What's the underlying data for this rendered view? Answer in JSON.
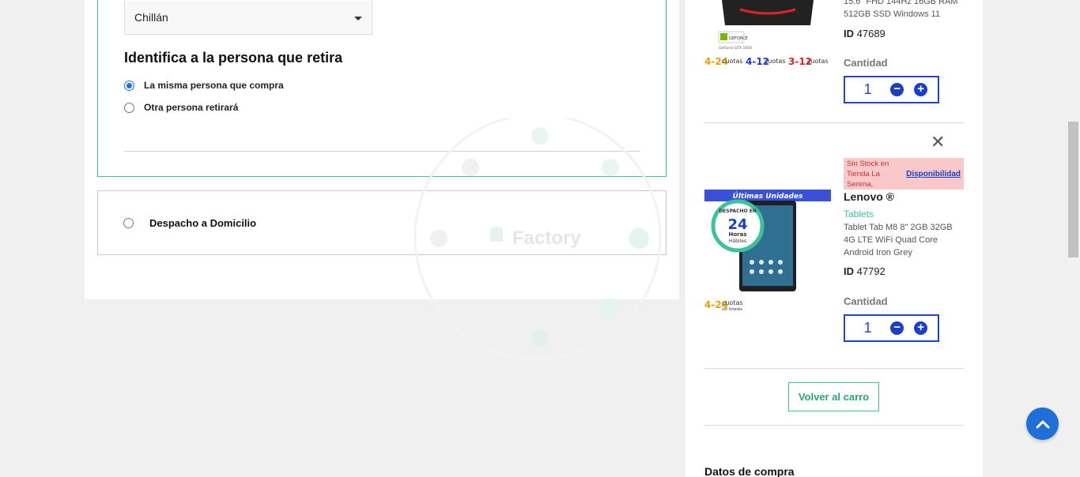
{
  "pickup": {
    "city_selected": "Chillán",
    "identify_title": "Identifica a la persona que retira",
    "option_same": "La misma persona que compra",
    "option_other": "Otra persona retirará"
  },
  "delivery": {
    "label": "Despacho a Domicilio"
  },
  "watermark": {
    "text": "Factory"
  },
  "cart": {
    "item1": {
      "desc_tail": "15.6\" FHD 144Hz 16GB RAM 512GB SSD Windows 11",
      "id_label": "ID",
      "id_value": "47689",
      "qty_label": "Cantidad",
      "qty_value": "1"
    },
    "item2": {
      "stock_text": "Sin Stock en Tienda La Serena,",
      "availability_link": "Disponibilidad",
      "brand": "Lenovo ®",
      "category": "Tablets",
      "description": "Tablet Tab M8 8\" 2GB 32GB 4G LTE WiFi Quad Core Android Iron Grey",
      "banner": "Últimas Unidades",
      "badge_top": "DESPACHO EN",
      "badge_num": "24",
      "badge_line1": "Horas",
      "badge_line2": "Hábiles",
      "id_label": "ID",
      "id_value": "47792",
      "qty_label": "Cantidad",
      "qty_value": "1"
    },
    "installments": {
      "a_num": "4-24",
      "b_num": "4-12",
      "c_num": "3-12",
      "word1": "cuotas",
      "word2": "sin interés"
    },
    "back_button": "Volver al carro",
    "summary_title": "Datos de compra"
  },
  "colors": {
    "accent_green": "#3cc39a",
    "qty_blue": "#2244cc",
    "fab_blue": "#1f6fd6",
    "stock_bg": "#f9c9c9"
  }
}
